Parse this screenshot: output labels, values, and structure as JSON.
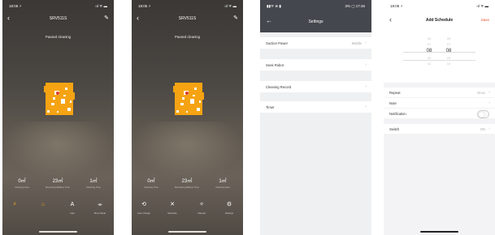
{
  "screens": [
    {
      "status_time": "18:05 ⚡",
      "status_signal": "ııl ᯤ ▬",
      "title": "SRV511S",
      "status_text": "Paused cleaning",
      "stats": [
        {
          "value": "0㎡",
          "label": "Cleaning Area"
        },
        {
          "value": "23㎡",
          "label": "Remaining Battery Time"
        },
        {
          "value": "1㎡",
          "label": "Cleaning Time"
        }
      ],
      "controls": [
        {
          "icon": "⚡",
          "label": ""
        },
        {
          "icon": "⌂",
          "label": ""
        },
        {
          "icon": "A",
          "label": "Auto"
        },
        {
          "icon": "⌯",
          "label": "More Mode"
        }
      ]
    },
    {
      "status_time": "18:05 ⚡",
      "status_signal": "ııl ᯤ ▬",
      "title": "SRV511S",
      "status_text": "Paused cleaning",
      "stats": [
        {
          "value": "0㎡",
          "label": "Cleaning Time"
        },
        {
          "value": "23㎡",
          "label": "Remaining Battery Time"
        },
        {
          "value": "1㎡",
          "label": "Cleaning Area"
        }
      ],
      "controls": [
        {
          "icon": "⟲",
          "label": "Auto Charge"
        },
        {
          "icon": "✕",
          "label": "Schedule"
        },
        {
          "icon": "✧",
          "label": "Manual"
        },
        {
          "icon": "⚙",
          "label": "Settings"
        }
      ]
    }
  ],
  "settings": {
    "status_left": "▮▮ᯤ ⊕ ▮",
    "status_right": "3% ▢ 17:46",
    "title": "Settings",
    "rows": [
      {
        "label": "Suction Power",
        "value": "Middle"
      },
      {
        "label": "Seek Robot",
        "value": ""
      },
      {
        "label": "Cleaning Record",
        "value": ""
      },
      {
        "label": "Timer",
        "value": ""
      }
    ]
  },
  "schedule": {
    "status_time": "18:05 ⚡",
    "status_right": "ııl ᯤ ▬",
    "title": "Add Schedule",
    "save": "Save",
    "hours": [
      "06",
      "07",
      "08",
      "09",
      "10"
    ],
    "minutes": [
      "06",
      "07",
      "08",
      "09",
      "10"
    ],
    "rows": {
      "repeat": {
        "label": "Repeat",
        "value": "Once"
      },
      "note": {
        "label": "Note",
        "value": ""
      },
      "notification": {
        "label": "Notification",
        "value": ""
      },
      "switch": {
        "label": "Switch",
        "value": "ON"
      }
    }
  },
  "colors": {
    "accent": "#f6a21b",
    "save": "#e8512a",
    "settings_header": "#44474d"
  }
}
